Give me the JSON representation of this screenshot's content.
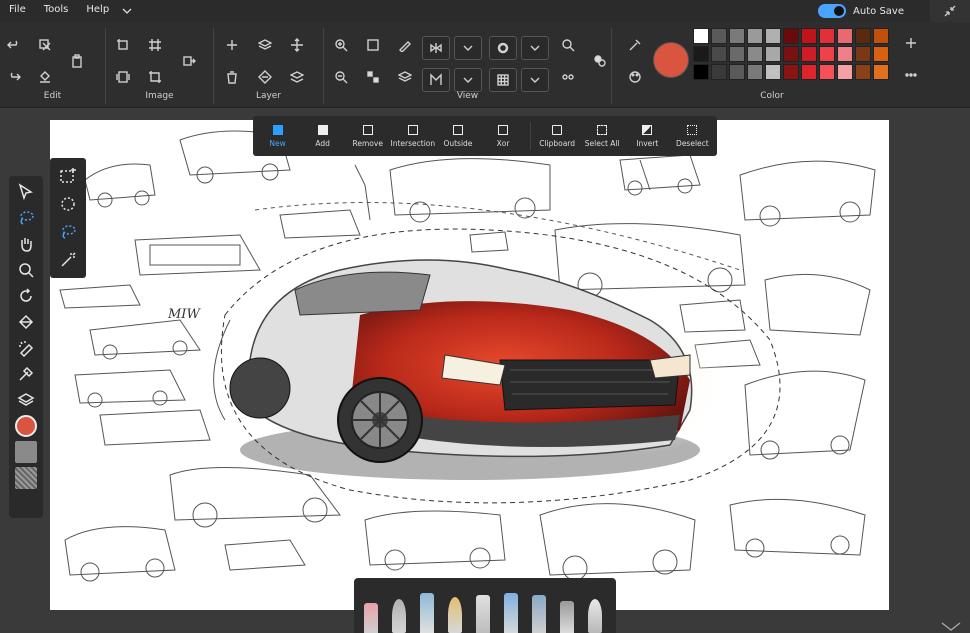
{
  "menu": {
    "items": [
      "File",
      "Tools",
      "Help"
    ]
  },
  "autosave": {
    "label": "Auto Save",
    "enabled": true
  },
  "ribbon": {
    "groups": {
      "edit": "Edit",
      "image": "Image",
      "layer": "Layer",
      "view": "View",
      "color": "Color"
    }
  },
  "color": {
    "current": "#d9553f",
    "swatches": [
      "#ffffff",
      "#5a5a5a",
      "#7a7a7a",
      "#9a9a9a",
      "#b0b0b0",
      "#6a0a0a",
      "#c0141a",
      "#e0303a",
      "#e86a70",
      "#5a2a10",
      "#c0500a",
      "#1a1a1a",
      "#4a4a4a",
      "#6a6a6a",
      "#8a8a8a",
      "#a8a8a8",
      "#7a1010",
      "#d01c24",
      "#f04048",
      "#f08088",
      "#7a3814",
      "#d86010",
      "#000000",
      "#3a3a3a",
      "#5a5a5a",
      "#7a7a7a",
      "#c0c0c0",
      "#8a1414",
      "#e0242c",
      "#f85058",
      "#f4a0a4",
      "#8a4018",
      "#e07020"
    ]
  },
  "selection_toolbar": {
    "buttons": [
      "New",
      "Add",
      "Remove",
      "Intersection",
      "Outside",
      "Xor",
      "Clipboard",
      "Select All",
      "Invert",
      "Deselect"
    ],
    "active": "New"
  },
  "canvas": {
    "signature": "MIW"
  },
  "left_tools": {
    "items": [
      "select-tool",
      "lasso-selection-tool",
      "pan-tool",
      "zoom-tool",
      "rotate-tool",
      "fill-tool",
      "magic-eraser-tool",
      "eyedropper-tool",
      "layers-tool",
      "color-tool",
      "texture-tool",
      "pattern-tool"
    ]
  },
  "selection_shapes": {
    "items": [
      "rectangle-selection",
      "ellipse-selection",
      "lasso-selection",
      "magic-wand-selection"
    ]
  }
}
